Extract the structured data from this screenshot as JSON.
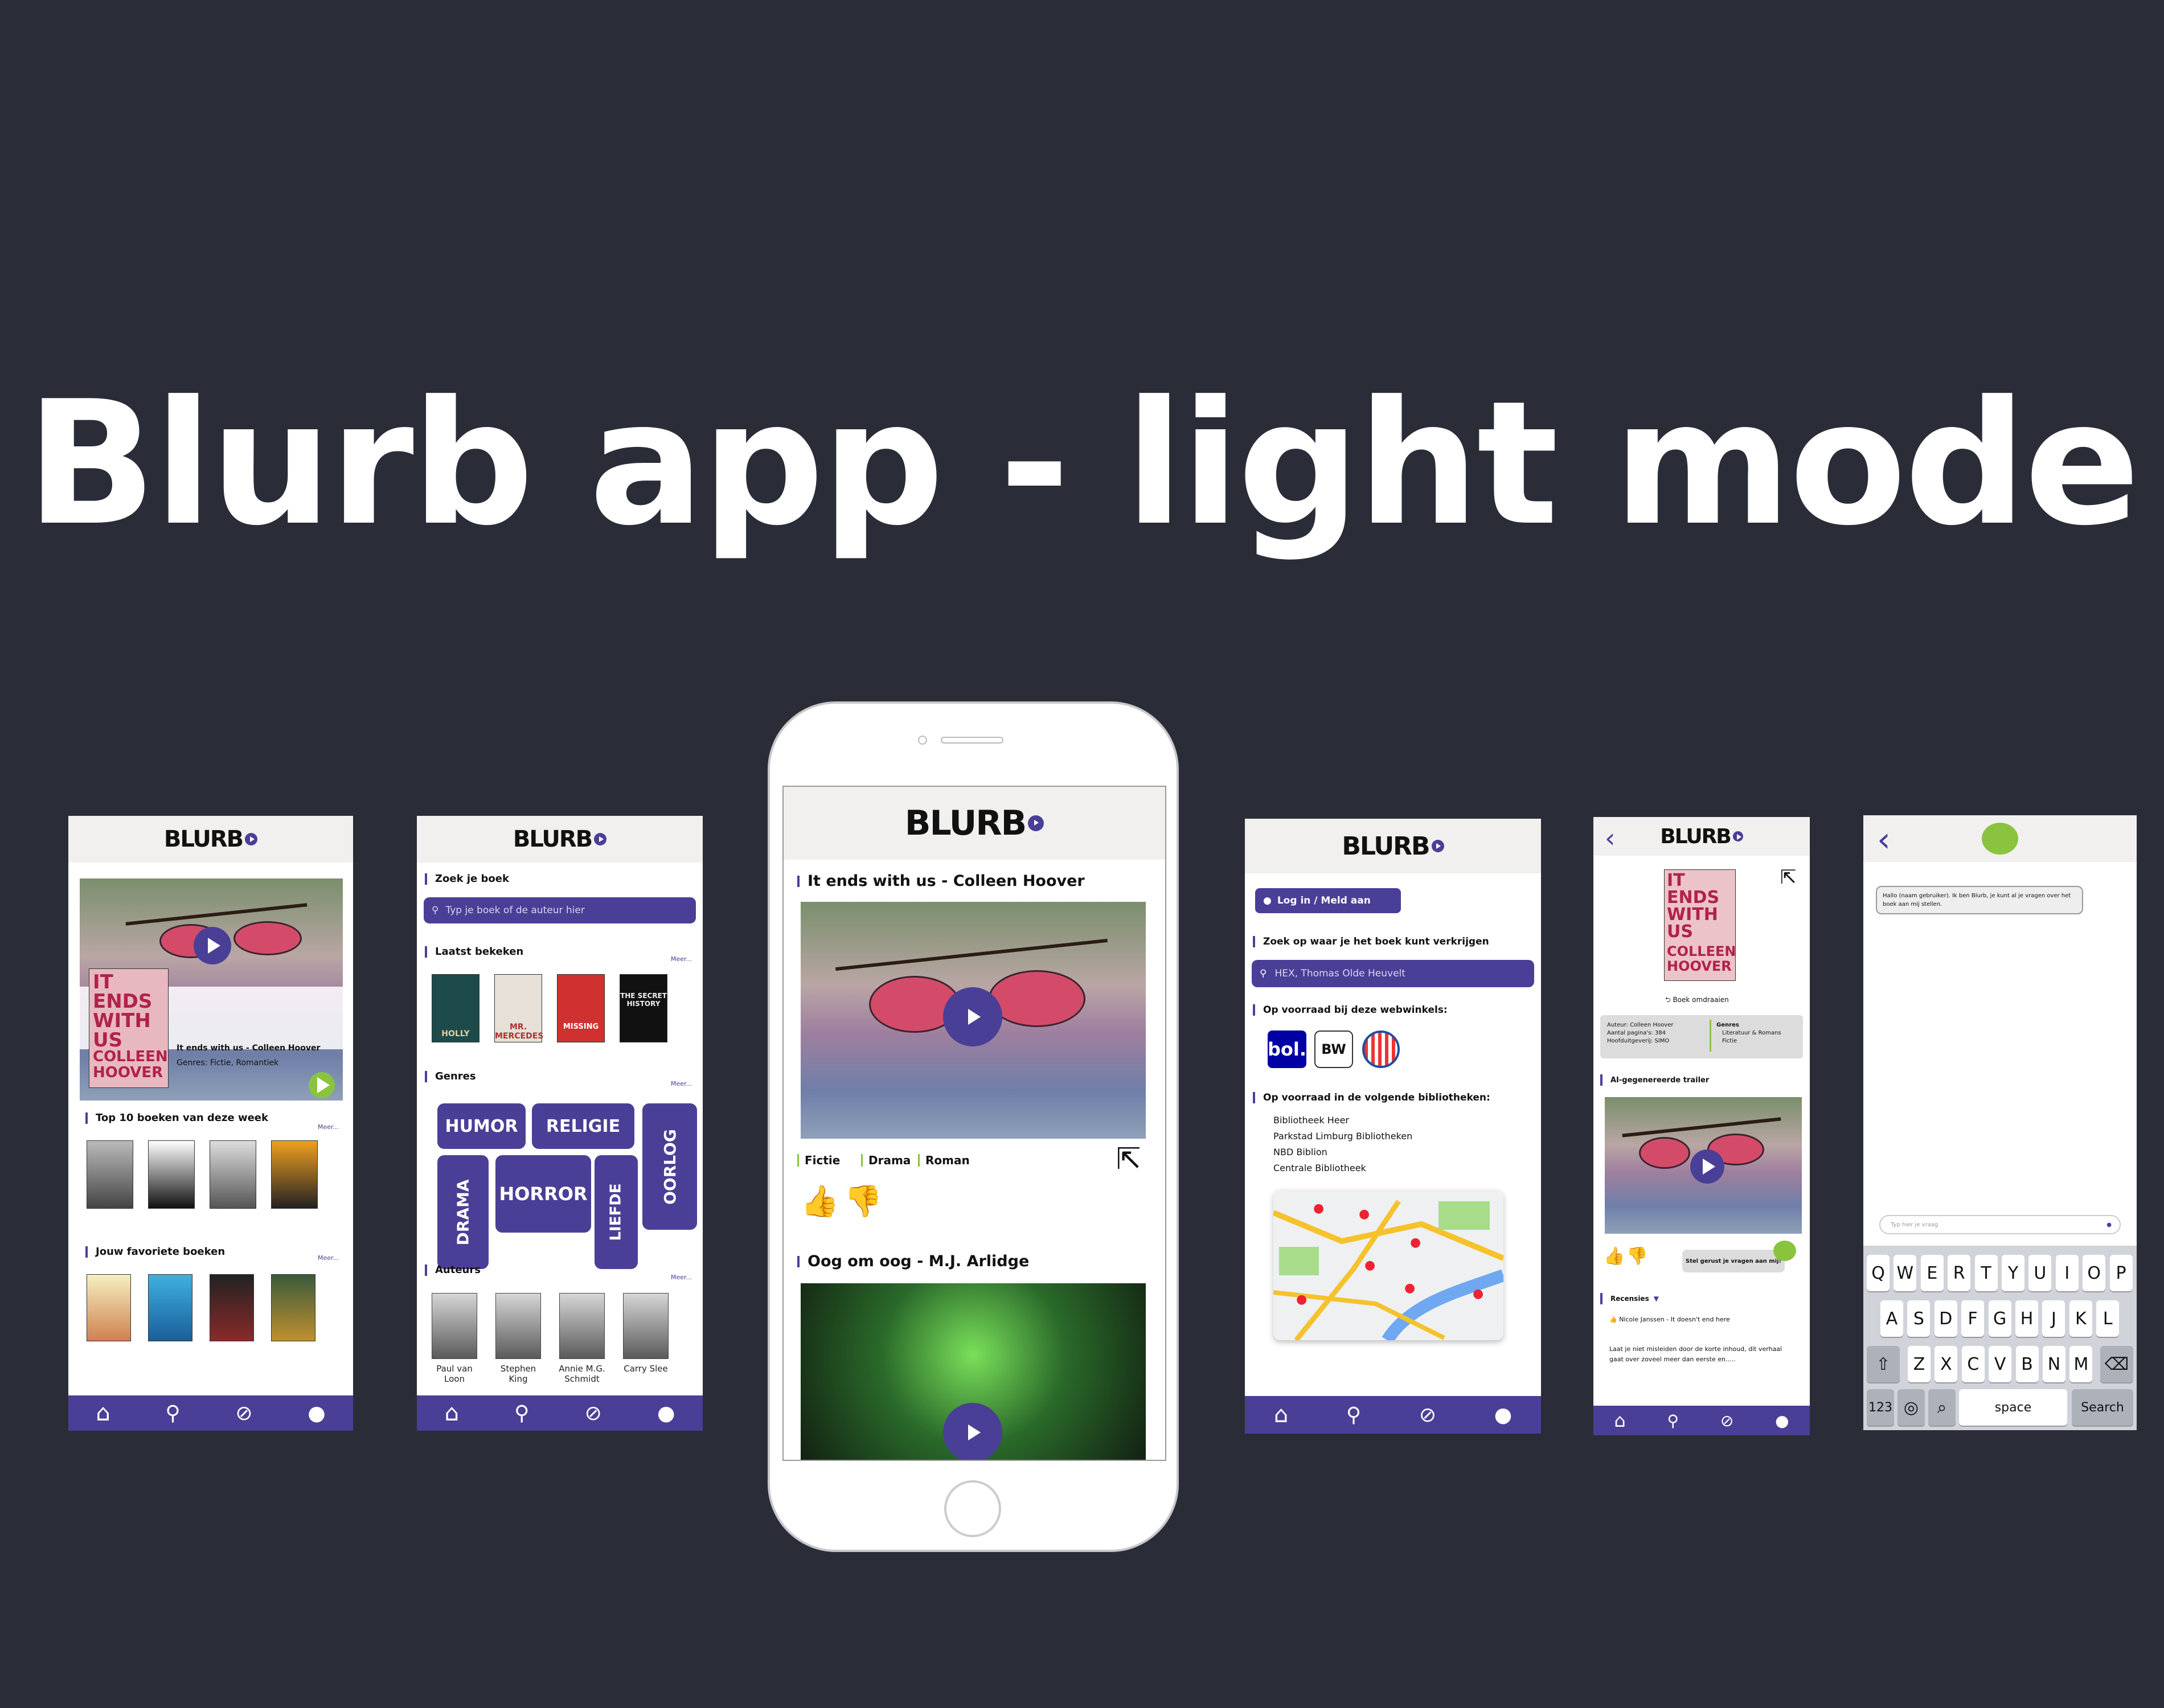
{
  "page_title": "Blurb app - light mode",
  "brand": {
    "logo": "BLURB",
    "accent": "#4a3f96",
    "green": "#8ac43f",
    "background": "#2a2d37"
  },
  "nav_icons": [
    "home-icon",
    "search-icon",
    "compass-icon",
    "profile-icon"
  ],
  "screen1": {
    "featured_title": "It ends with us - Colleen Hoover",
    "featured_genres": "Genres: Fictie, Romantiek",
    "featured_cover": "IT ENDS WITH US",
    "featured_cover_author": "COLLEEN HOOVER",
    "top10_title": "Top 10 boeken van deze week",
    "favorites_title": "Jouw favoriete boeken",
    "more": "Meer..."
  },
  "screen2": {
    "search_title": "Zoek je boek",
    "search_placeholder": "Typ je boek of de auteur hier",
    "recent_title": "Laatst bekeken",
    "recent_covers": [
      "HOLLY",
      "MR. MERCEDES",
      "MISSING",
      "THE SECRET HISTORY"
    ],
    "genres_title": "Genres",
    "genres": [
      "HUMOR",
      "RELIGIE",
      "DRAMA",
      "HORROR",
      "LIEFDE",
      "OORLOG"
    ],
    "authors_title": "Auteurs",
    "authors": [
      "Paul van Loon",
      "Stephen King",
      "Annie M.G. Schmidt",
      "Carry Slee"
    ],
    "more": "Meer..."
  },
  "screen3": {
    "book1_title": "It ends with us - Colleen Hoover",
    "tags": [
      "Fictie",
      "Drama",
      "Roman"
    ],
    "book2_title": "Oog om oog - M.J. Arlidge"
  },
  "screen4": {
    "login": "Log in / Meld aan",
    "find_title": "Zoek op waar je het boek kunt verkrijgen",
    "location_value": "HEX, Thomas Olde Heuvelt",
    "shops_title": "Op voorraad bij deze webwinkels:",
    "shops": [
      "bol.",
      "BW"
    ],
    "libraries_title": "Op voorraad in de volgende bibliotheken:",
    "libraries": [
      "Bibliotheek Heer",
      "Parkstad Limburg Bibliotheken",
      "NBD Biblion",
      "Centrale Bibliotheek"
    ]
  },
  "screen5": {
    "flip": "Boek omdraaien",
    "info_author": "Auteur: Colleen Hoover",
    "info_pages": "Aantal pagina's: 384",
    "info_publisher": "Hoofduitgeverij: SIMO",
    "genres_label": "Genres",
    "genres": [
      "Literatuur & Romans",
      "Fictie"
    ],
    "trailer_title": "AI-gegenereerde trailer",
    "ask_bubble": "Stel gerust je vragen aan mij!",
    "reviews_title": "Recensies",
    "review_author": "Nicole Janssen",
    "review_book": "It doesn't end here",
    "review_text": "Laat je niet misleiden door de korte inhoud, dit verhaal gaat over zoveel meer dan eerste en....."
  },
  "screen6": {
    "chat_message": "Hallo (naam gebruiker). Ik ben Blurb, je kunt al je vragen over het boek aan mij stellen.",
    "input_placeholder": "Typ hier je vraag",
    "keyboard_row1": [
      "Q",
      "W",
      "E",
      "R",
      "T",
      "Y",
      "U",
      "I",
      "O",
      "P"
    ],
    "keyboard_row2": [
      "A",
      "S",
      "D",
      "F",
      "G",
      "H",
      "J",
      "K",
      "L"
    ],
    "keyboard_row3": [
      "Z",
      "X",
      "C",
      "V",
      "B",
      "N",
      "M"
    ],
    "key_123": "123",
    "key_space": "space",
    "key_search": "Search"
  }
}
